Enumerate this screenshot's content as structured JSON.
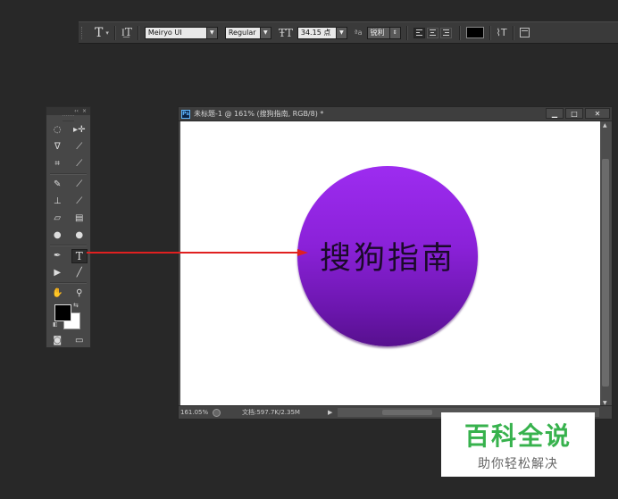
{
  "options_bar": {
    "font_family": "Meiryo UI",
    "font_style": "Regular",
    "font_size": "34.15 点",
    "aa_label": "ªa",
    "anti_alias": "锐利",
    "text_color": "#000000"
  },
  "tools_panel": {
    "header_collapse": "‹‹",
    "header_close": "×"
  },
  "document": {
    "title": "未标题-1 @ 161% (搜狗指南, RGB/8) *",
    "canvas_text": "搜狗指南",
    "circle_color_top": "#9d2cf0",
    "circle_color_bottom": "#57108e",
    "status": {
      "zoom": "161.05%",
      "doc_info": "文档:597.7K/2.35M"
    }
  },
  "annotation": {
    "arrow_color": "#e02020"
  },
  "watermark": {
    "main": "百科全说",
    "sub": "助你轻松解决"
  }
}
